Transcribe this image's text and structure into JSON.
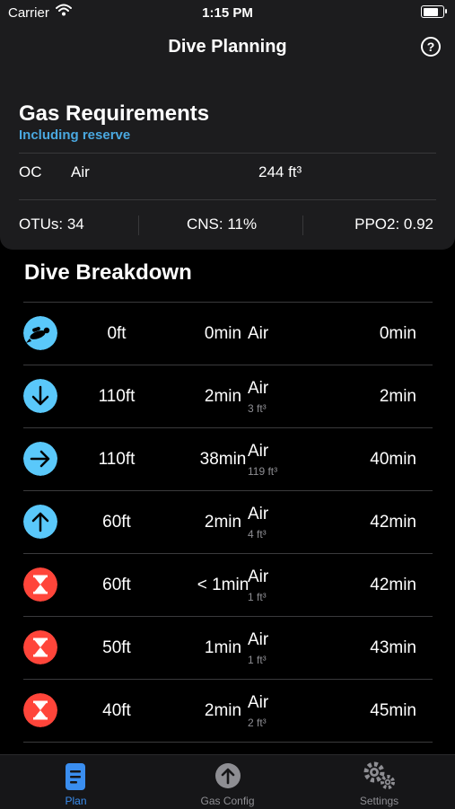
{
  "status_bar": {
    "carrier": "Carrier",
    "time": "1:15 PM",
    "battery_level": 0.9
  },
  "nav": {
    "title": "Dive Planning",
    "help_icon_text": "?"
  },
  "gas_card": {
    "title": "Gas Requirements",
    "subtitle": "Including reserve",
    "mode": "OC",
    "gas": "Air",
    "volume": "244 ft³",
    "otus": "OTUs: 34",
    "cns": "CNS: 11%",
    "ppo2": "PPO2: 0.92",
    "subtitle_color": "#4aa8e0"
  },
  "breakdown": {
    "title": "Dive Breakdown",
    "rows": [
      {
        "icon": "diver-icon",
        "depth": "0ft",
        "time": "0min",
        "gas": "Air",
        "gas_volume": "",
        "runtime": "0min"
      },
      {
        "icon": "arrow-down-icon",
        "depth": "110ft",
        "time": "2min",
        "gas": "Air",
        "gas_volume": "3 ft³",
        "runtime": "2min"
      },
      {
        "icon": "arrow-right-icon",
        "depth": "110ft",
        "time": "38min",
        "gas": "Air",
        "gas_volume": "119 ft³",
        "runtime": "40min"
      },
      {
        "icon": "arrow-up-icon",
        "depth": "60ft",
        "time": "2min",
        "gas": "Air",
        "gas_volume": "4 ft³",
        "runtime": "42min"
      },
      {
        "icon": "hourglass-icon",
        "depth": "60ft",
        "time": "< 1min",
        "gas": "Air",
        "gas_volume": "1 ft³",
        "runtime": "42min"
      },
      {
        "icon": "hourglass-icon",
        "depth": "50ft",
        "time": "1min",
        "gas": "Air",
        "gas_volume": "1 ft³",
        "runtime": "43min"
      },
      {
        "icon": "hourglass-icon",
        "depth": "40ft",
        "time": "2min",
        "gas": "Air",
        "gas_volume": "2 ft³",
        "runtime": "45min"
      }
    ]
  },
  "tabbar": {
    "tabs": [
      {
        "label": "Plan",
        "icon": "document-icon",
        "active": true
      },
      {
        "label": "Gas Config",
        "icon": "arrow-up-circle-icon",
        "active": false
      },
      {
        "label": "Settings",
        "icon": "gears-icon",
        "active": false
      }
    ]
  },
  "colors": {
    "blue_icon": "#5ac8fa",
    "red_icon": "#ff453a",
    "active_tab": "#3a8ef0"
  }
}
